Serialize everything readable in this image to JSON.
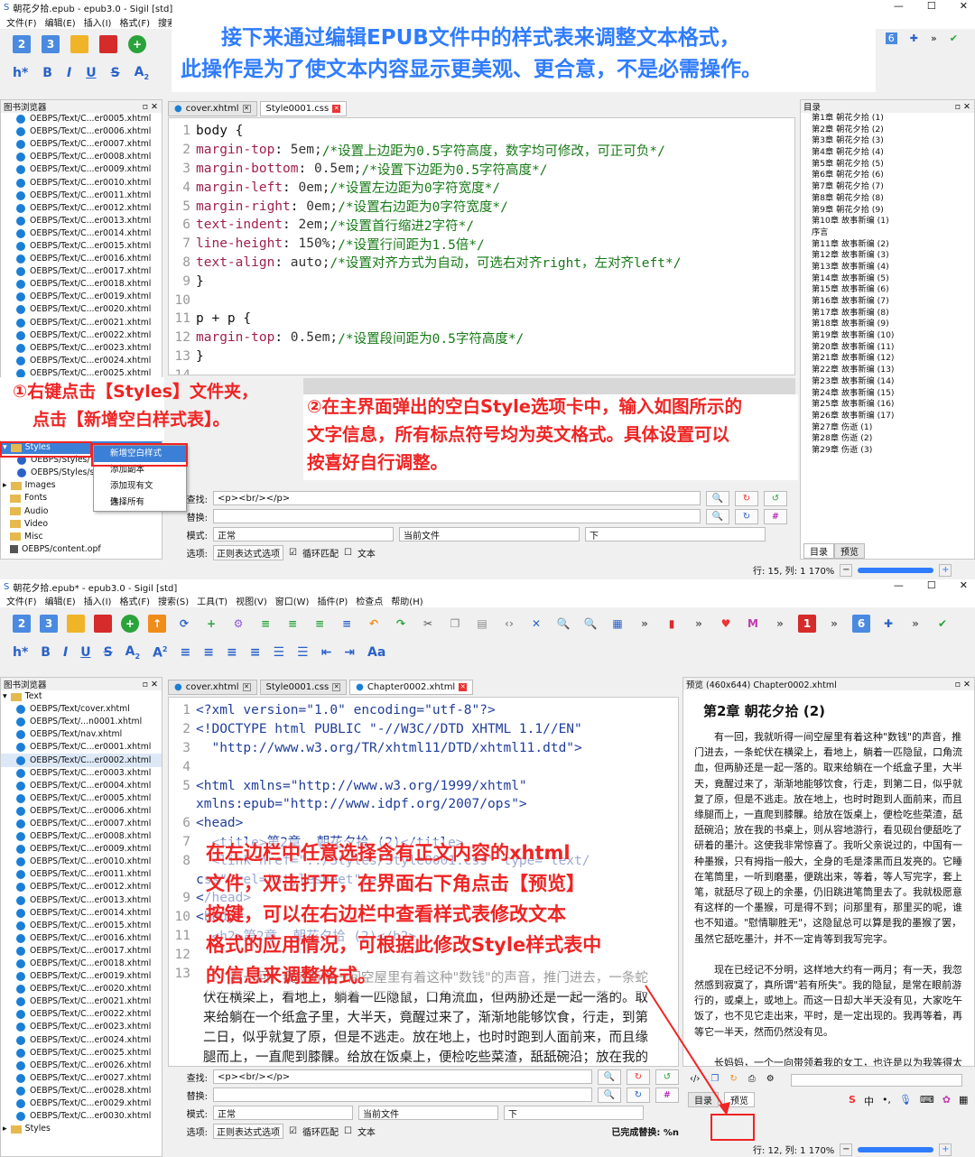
{
  "top": {
    "title": "朝花夕拾.epub - epub3.0 - Sigil [std]",
    "menu_partial": [
      "文件(F)",
      "编辑(E)",
      "插入(I)",
      "格式(F)",
      "搜索"
    ],
    "book_browser": "图书浏览器",
    "files": [
      "OEBPS/Text/C...er0005.xhtml",
      "OEBPS/Text/C...er0006.xhtml",
      "OEBPS/Text/C...er0007.xhtml",
      "OEBPS/Text/C...er0008.xhtml",
      "OEBPS/Text/C...er0009.xhtml",
      "OEBPS/Text/C...er0010.xhtml",
      "OEBPS/Text/C...er0011.xhtml",
      "OEBPS/Text/C...er0012.xhtml",
      "OEBPS/Text/C...er0013.xhtml",
      "OEBPS/Text/C...er0014.xhtml",
      "OEBPS/Text/C...er0015.xhtml",
      "OEBPS/Text/C...er0016.xhtml",
      "OEBPS/Text/C...er0017.xhtml",
      "OEBPS/Text/C...er0018.xhtml",
      "OEBPS/Text/C...er0019.xhtml",
      "OEBPS/Text/C...er0020.xhtml",
      "OEBPS/Text/C...er0021.xhtml",
      "OEBPS/Text/C...er0022.xhtml",
      "OEBPS/Text/C...er0023.xhtml",
      "OEBPS/Text/C...er0024.xhtml",
      "OEBPS/Text/C...er0025.xhtml"
    ],
    "folders": [
      "Styles",
      "OEBPS/Styles/",
      "OEBPS/Styles/s",
      "Images",
      "Fonts",
      "Audio",
      "Video",
      "Misc",
      "OEBPS/content.opf"
    ],
    "context_menu": [
      "新增空白样式表",
      "添加副本",
      "添加现有文件...",
      "选择所有"
    ],
    "tab1": "cover.xhtml",
    "tab2": "Style0001.css",
    "code": [
      {
        "n": "1",
        "t": "body {"
      },
      {
        "n": "2",
        "p": "margin-top",
        "v": "5em;",
        "c": "/*设置上边距为0.5字符高度，数字均可修改，可正可负*/"
      },
      {
        "n": "3",
        "p": "margin-bottom",
        "v": "0.5em;",
        "c": "/*设置下边距为0.5字符高度*/"
      },
      {
        "n": "4",
        "p": "margin-left",
        "v": "0em;",
        "c": "/*设置左边距为0字符宽度*/"
      },
      {
        "n": "5",
        "p": "margin-right",
        "v": "0em;",
        "c": "/*设置右边距为0字符宽度*/"
      },
      {
        "n": "6",
        "p": "text-indent",
        "v": "2em;",
        "c": "/*设置首行缩进2字符*/"
      },
      {
        "n": "7",
        "p": "line-height",
        "v": "150%;",
        "c": "/*设置行间距为1.5倍*/"
      },
      {
        "n": "8",
        "p": "text-align",
        "v": "auto;",
        "c": "/*设置对齐方式为自动，可选右对齐right，左对齐left*/"
      },
      {
        "n": "9",
        "t": "}"
      },
      {
        "n": "10",
        "t": ""
      },
      {
        "n": "11",
        "t": "p + p {"
      },
      {
        "n": "12",
        "p": "margin-top",
        "v": "0.5em;",
        "c": "/*设置段间距为0.5字符高度*/"
      },
      {
        "n": "13",
        "t": "}"
      },
      {
        "n": "14",
        "t": ""
      }
    ],
    "find_label": "查找:",
    "find_value": "<p><br/></p>",
    "replace_label": "替换:",
    "mode_label": "模式:",
    "mode_value": "正常",
    "scope_value": "当前文件",
    "dir_value": "下",
    "options_label": "选项:",
    "opt_regex": "正则表达式选项",
    "opt_loop": "循环匹配",
    "opt_text": "文本",
    "toc_title": "目录",
    "toc": [
      "第1章 朝花夕拾 (1)",
      "第2章 朝花夕拾 (2)",
      "第3章 朝花夕拾 (3)",
      "第4章 朝花夕拾 (4)",
      "第5章 朝花夕拾 (5)",
      "第6章 朝花夕拾 (6)",
      "第7章 朝花夕拾 (7)",
      "第8章 朝花夕拾 (8)",
      "第9章 朝花夕拾 (9)",
      "第10章 故事新编 (1)",
      "序言",
      "第11章 故事新编 (2)",
      "第12章 故事新编 (3)",
      "第13章 故事新编 (4)",
      "第14章 故事新编 (5)",
      "第15章 故事新编 (6)",
      "第16章 故事新编 (7)",
      "第17章 故事新编 (8)",
      "第18章 故事新编 (9)",
      "第19章 故事新编 (10)",
      "第20章 故事新编 (11)",
      "第21章 故事新编 (12)",
      "第22章 故事新编 (13)",
      "第23章 故事新编 (14)",
      "第24章 故事新编 (15)",
      "第25章 故事新编 (16)",
      "第26章 故事新编 (17)",
      "第27章 伤逝 (1)",
      "第28章 伤逝 (2)",
      "第29章 伤逝 (3)"
    ],
    "toc_tab": "目录",
    "preview_tab": "预览",
    "status": "行: 15,  列: 1  170%"
  },
  "bottom": {
    "title": "朝花夕拾.epub* - epub3.0 - Sigil [std]",
    "menu": [
      "文件(F)",
      "编辑(E)",
      "插入(I)",
      "格式(F)",
      "搜索(S)",
      "工具(T)",
      "视图(V)",
      "窗口(W)",
      "插件(P)",
      "检查点",
      "帮助(H)"
    ],
    "book_browser": "图书浏览器",
    "root": "Text",
    "files": [
      "OEBPS/Text/cover.xhtml",
      "OEBPS/Text/...n0001.xhtml",
      "OEBPS/Text/nav.xhtml",
      "OEBPS/Text/C...er0001.xhtml",
      "OEBPS/Text/C...er0002.xhtml",
      "OEBPS/Text/C...er0003.xhtml",
      "OEBPS/Text/C...er0004.xhtml",
      "OEBPS/Text/C...er0005.xhtml",
      "OEBPS/Text/C...er0006.xhtml",
      "OEBPS/Text/C...er0007.xhtml",
      "OEBPS/Text/C...er0008.xhtml",
      "OEBPS/Text/C...er0009.xhtml",
      "OEBPS/Text/C...er0010.xhtml",
      "OEBPS/Text/C...er0011.xhtml",
      "OEBPS/Text/C...er0012.xhtml",
      "OEBPS/Text/C...er0013.xhtml",
      "OEBPS/Text/C...er0014.xhtml",
      "OEBPS/Text/C...er0015.xhtml",
      "OEBPS/Text/C...er0016.xhtml",
      "OEBPS/Text/C...er0017.xhtml",
      "OEBPS/Text/C...er0018.xhtml",
      "OEBPS/Text/C...er0019.xhtml",
      "OEBPS/Text/C...er0020.xhtml",
      "OEBPS/Text/C...er0021.xhtml",
      "OEBPS/Text/C...er0022.xhtml",
      "OEBPS/Text/C...er0023.xhtml",
      "OEBPS/Text/C...er0024.xhtml",
      "OEBPS/Text/C...er0025.xhtml",
      "OEBPS/Text/C...er0026.xhtml",
      "OEBPS/Text/C...er0027.xhtml",
      "OEBPS/Text/C...er0028.xhtml",
      "OEBPS/Text/C...er0029.xhtml",
      "OEBPS/Text/C...er0030.xhtml"
    ],
    "styles_folder": "Styles",
    "tabs": [
      "cover.xhtml",
      "Style0001.css",
      "Chapter0002.xhtml"
    ],
    "code": [
      {
        "n": "1",
        "t": "<?xml version=\"1.0\" encoding=\"utf-8\"?>"
      },
      {
        "n": "2",
        "t": "<!DOCTYPE html PUBLIC \"-//W3C//DTD XHTML 1.1//EN\""
      },
      {
        "n": "3",
        "t": "  \"http://www.w3.org/TR/xhtml11/DTD/xhtml11.dtd\">"
      },
      {
        "n": "4",
        "t": ""
      },
      {
        "n": "5",
        "t": "<html xmlns=\"http://www.w3.org/1999/xhtml\""
      },
      {
        "n": "",
        "t": "xmlns:epub=\"http://www.idpf.org/2007/ops\">"
      },
      {
        "n": "6",
        "t": "<head>"
      },
      {
        "n": "7",
        "t": "  <title>第2章  朝花夕拾 (2)</title>"
      },
      {
        "n": "8",
        "t": "  <link href=\"../Styles/Style0001.css\" type=\"text/"
      },
      {
        "n": "",
        "t": "css\" rel=\"stylesheet\"/>"
      },
      {
        "n": "9",
        "t": "</head>"
      },
      {
        "n": "10",
        "t": "<body>"
      },
      {
        "n": "11",
        "t": "  <h2>第2章  朝花夕拾 (2)</h2>"
      },
      {
        "n": "12",
        "t": ""
      },
      {
        "n": "13",
        "t": ""
      }
    ],
    "body_text": [
      "有一回，我就听得一间空屋里有着这种\"数钱\"的声音，推门进去，一条蛇伏在横梁上，看地上，躺着一匹隐鼠，口角流血，但两胁还是一起一落的。取来给躺在一个纸盒子里，大半天，竟醒过来了，渐渐地能够饮食，行走，到第二日，似乎就复了原，但是不逃走。放在地上，也时时跑到人面前来，而且缘腿而上，一直爬到膝髁。给放在饭桌上，便检吃些菜渣，舐舐碗沿；放在我的书桌上，则从容地游行，看见砚台便舐吃了研着的墨汁。"
    ],
    "find_label": "查找:",
    "find_value": "<p><br/></p>",
    "replace_label": "替换:",
    "mode_label": "模式:",
    "mode_value": "正常",
    "scope_value": "当前文件",
    "dir_value": "下",
    "options_label": "选项:",
    "opt_regex": "正则表达式选项",
    "opt_loop": "循环匹配",
    "opt_text": "文本",
    "replace_done": "已完成替换: %n",
    "preview_header": "预览 (460x644) Chapter0002.xhtml",
    "preview_title": "第2章 朝花夕拾 (2)",
    "preview_paras": [
      "有一回，我就听得一间空屋里有着这种\"数钱\"的声音，推门进去，一条蛇伏在横梁上，看地上，躺着一匹隐鼠，口角流血，但两胁还是一起一落的。取来给躺在一个纸盒子里，大半天，竟醒过来了，渐渐地能够饮食，行走，到第二日，似乎就复了原，但是不逃走。放在地上，也时时跑到人面前来，而且缘腿而上，一直爬到膝髁。给放在饭桌上，便检吃些菜渣，舐舐碗沿；放在我的书桌上，则从容地游行，看见砚台便舐吃了研着的墨汁。这使我非常惊喜了。我听父亲说过的，中国有一种墨猴，只有拇指一般大，全身的毛是漆黑而且发亮的。它睡在笔筒里，一听到磨墨，便跳出来，等着，等人写完字，套上笔，就舐尽了砚上的余墨，仍旧跳进笔筒里去了。我就极愿意有这样的一个墨猴，可是得不到；问那里有，那里买的呢，谁也不知道。\"慰情聊胜无\"，这隐鼠总可以算是我的墨猴了罢，虽然它舐吃墨汁，并不一定肯等到我写完字。",
      "现在已经记不分明，这样地大约有一两月；有一天，我忽然感到寂寞了，真所谓\"若有所失\"。我的隐鼠，是常在眼前游行的，或桌上，或地上。而这一日却大半天没有见，大家吃午饭了，也不见它走出来，平时，是一定出现的。我再等着，再等它一半天，然而仍然没有见。",
      "长妈妈，一个一向带领着我的女工，也许是以为我等得太苦了罢，轻轻地来告诉我一句话。这即刻使我愤怒而且悲哀，决心和猫们为敌。她说：隐鼠是昨天晚上被猫吃去了！"
    ],
    "toc_tab": "目录",
    "preview_btn": "预览",
    "status": "行: 12,  列: 1  170%"
  },
  "annotations": {
    "top_banner_1": "接下来通过编辑EPUB文件中的样式表来调整文本格式，",
    "top_banner_2": "此操作是为了使文本内容显示更美观、更合意，不是必需操作。",
    "step1_a": "①右键点击【Styles】文件夹，",
    "step1_b": "点击【新增空白样式表】。",
    "step2_a": "②在主界面弹出的空白Style选项卡中，输入如图所示的",
    "step2_b": "文字信息，所有标点符号均为英文格式。具体设置可以",
    "step2_c": "按喜好自行调整。",
    "step3_a": "在左边栏中任意选择含有正文内容的xhtml",
    "step3_b": "文件，双击打开，在界面右下角点击【预览】",
    "step3_c": "按键，可以在右边栏中查看样式表修改文本",
    "step3_d": "格式的应用情况，可根据此修改Style样式表中",
    "step3_e": "的信息来调整格式。"
  },
  "colors": {
    "annotation_blue": "#2f7cff",
    "annotation_red": "#ef2424"
  }
}
